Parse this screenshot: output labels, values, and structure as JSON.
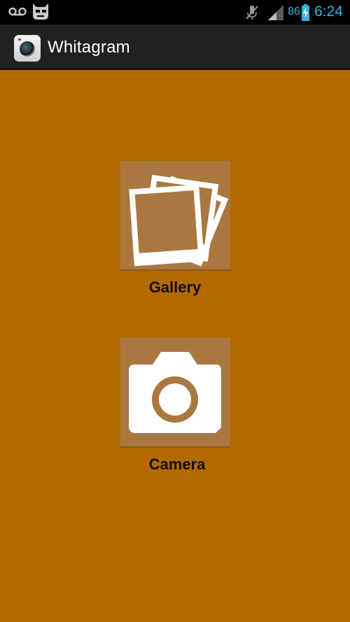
{
  "status_bar": {
    "battery_percent": "86",
    "time": "6:24",
    "accent_color": "#33b5e5",
    "left_icons": [
      "voicemail-icon",
      "cyanogenmod-icon"
    ],
    "right_icons": [
      "mute-icon",
      "signal-icon",
      "battery-charging-icon"
    ]
  },
  "action_bar": {
    "app_icon": "camera-lens-icon",
    "title": "Whitagram"
  },
  "main": {
    "background_color": "#b46800",
    "items": [
      {
        "label": "Gallery",
        "icon": "photos-icon"
      },
      {
        "label": "Camera",
        "icon": "camera-icon"
      }
    ]
  }
}
